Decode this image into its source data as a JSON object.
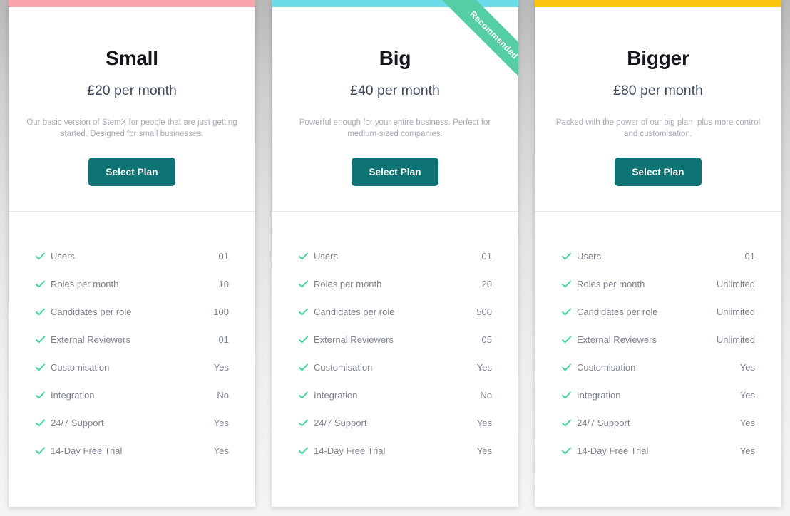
{
  "page": {
    "title": "Pricing Plans",
    "background_gradient_from": "#b8b8b8",
    "background_gradient_to": "#f4f4f4"
  },
  "common": {
    "select_plan_label": "Select Plan",
    "button_color": "#0d7375",
    "check_icon_color": "#3ed69a",
    "recommended_label": "Recommended",
    "ribbon_color": "#55cda5",
    "feature_names": [
      "Users",
      "Roles per month",
      "Candidates per role",
      "External Reviewers",
      "Customisation",
      "Integration",
      "24/7 Support",
      "14-Day Free Trial"
    ]
  },
  "plans": [
    {
      "name": "Small",
      "price": "£20 per month",
      "description": "Our basic version of StemX for people that are just getting started. Designed for small businesses.",
      "accent_color": "#f9a3ae",
      "recommended": false,
      "select_plan_label": "Select Plan",
      "features": [
        {
          "label": "Users",
          "value": "01"
        },
        {
          "label": "Roles per month",
          "value": "10"
        },
        {
          "label": "Candidates per role",
          "value": "100"
        },
        {
          "label": "External Reviewers",
          "value": "01"
        },
        {
          "label": "Customisation",
          "value": "Yes"
        },
        {
          "label": "Integration",
          "value": "No"
        },
        {
          "label": "24/7 Support",
          "value": "Yes"
        },
        {
          "label": "14-Day Free Trial",
          "value": "Yes"
        }
      ]
    },
    {
      "name": "Big",
      "price": "£40 per month",
      "description": "Powerful enough for your entire business. Perfect for medium-sized companies.",
      "accent_color": "#6bdcea",
      "recommended": true,
      "recommended_label": "Recommended",
      "select_plan_label": "Select Plan",
      "features": [
        {
          "label": "Users",
          "value": "01"
        },
        {
          "label": "Roles per month",
          "value": "20"
        },
        {
          "label": "Candidates per role",
          "value": "500"
        },
        {
          "label": "External Reviewers",
          "value": "05"
        },
        {
          "label": "Customisation",
          "value": "Yes"
        },
        {
          "label": "Integration",
          "value": "No"
        },
        {
          "label": "24/7 Support",
          "value": "Yes"
        },
        {
          "label": "14-Day Free Trial",
          "value": "Yes"
        }
      ]
    },
    {
      "name": "Bigger",
      "price": "£80 per month",
      "description": "Packed with the power of our big plan, plus more control and customisation.",
      "accent_color": "#fbc40c",
      "recommended": false,
      "select_plan_label": "Select Plan",
      "features": [
        {
          "label": "Users",
          "value": "01"
        },
        {
          "label": "Roles per month",
          "value": "Unlimited"
        },
        {
          "label": "Candidates per role",
          "value": "Unlimited"
        },
        {
          "label": "External Reviewers",
          "value": "Unlimited"
        },
        {
          "label": "Customisation",
          "value": "Yes"
        },
        {
          "label": "Integration",
          "value": "Yes"
        },
        {
          "label": "24/7 Support",
          "value": "Yes"
        },
        {
          "label": "14-Day Free Trial",
          "value": "Yes"
        }
      ]
    }
  ]
}
